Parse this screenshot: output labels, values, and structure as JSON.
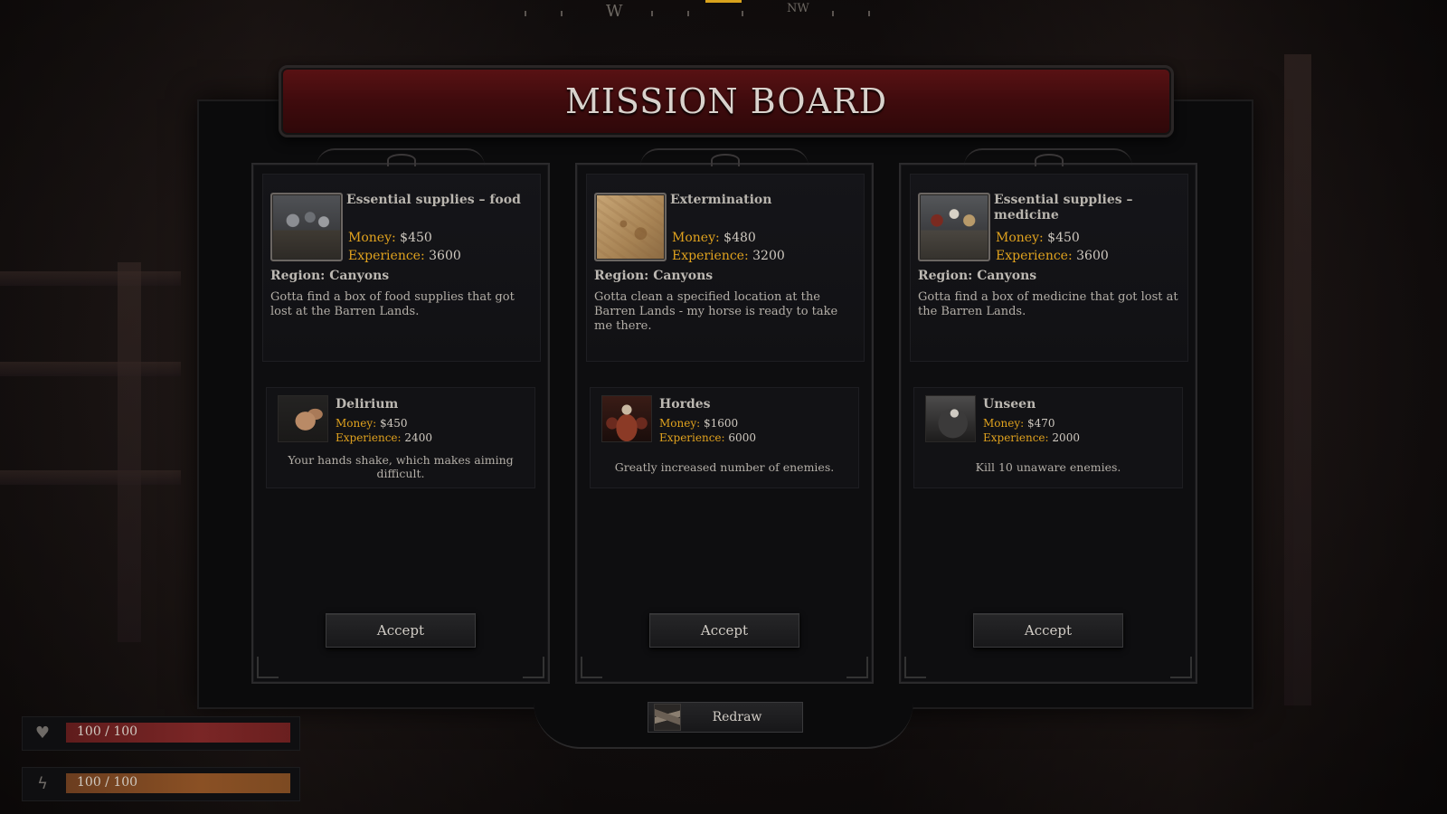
{
  "compass": {
    "west": "W",
    "northwest": "NW",
    "accent_color": "#d8a21c"
  },
  "board": {
    "title": "MISSION BOARD",
    "banner_color": "#4a0e10"
  },
  "labels": {
    "money": "Money:",
    "experience": "Experience:",
    "region": "Region:",
    "accept": "Accept",
    "redraw": "Redraw"
  },
  "cards": [
    {
      "mission": {
        "title": "Essential supplies – food",
        "thumbnail": "food-crate-icon",
        "money": "$450",
        "experience": "3600",
        "region": "Canyons",
        "description": "Gotta find a box of food supplies that got lost at the Barren Lands."
      },
      "modifier": {
        "title": "Delirium",
        "icon": "shaking-hand-icon",
        "money": "$450",
        "experience": "2400",
        "description": "Your hands shake, which makes aiming difficult."
      }
    },
    {
      "mission": {
        "title": "Extermination",
        "thumbnail": "treasure-map-icon",
        "money": "$480",
        "experience": "3200",
        "region": "Canyons",
        "description": "Gotta clean a specified location at the Barren Lands - my horse is ready to take me there."
      },
      "modifier": {
        "title": "Hordes",
        "icon": "horde-skull-icon",
        "money": "$1600",
        "experience": "6000",
        "description": "Greatly increased number of enemies."
      }
    },
    {
      "mission": {
        "title": "Essential supplies – medicine",
        "thumbnail": "medicine-crate-icon",
        "money": "$450",
        "experience": "3600",
        "region": "Canyons",
        "description": "Gotta find a box of medicine that got lost at the Barren Lands."
      },
      "modifier": {
        "title": "Unseen",
        "icon": "reaper-icon",
        "money": "$470",
        "experience": "2000",
        "description": "Kill 10 unaware enemies."
      }
    }
  ],
  "status": {
    "health": {
      "text": "100 / 100",
      "fraction": 1.0,
      "icon": "heart-icon",
      "color": "#7a2626"
    },
    "stamina": {
      "text": "100 / 100",
      "fraction": 1.0,
      "icon": "lightning-icon",
      "color": "#8a5024"
    }
  }
}
